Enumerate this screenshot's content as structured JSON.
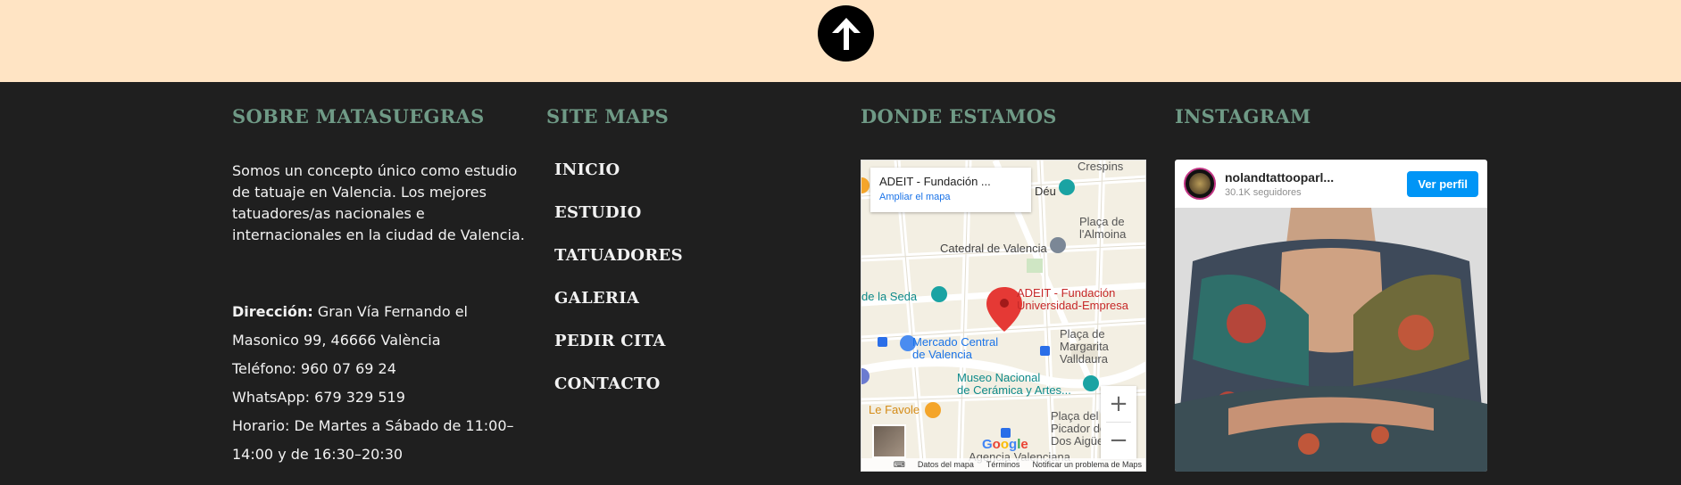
{
  "back_to_top": {
    "icon": "arrow-up-icon"
  },
  "columns": {
    "about": {
      "title": "SOBRE MATASUEGRAS",
      "text": "Somos un concepto único como estudio de tatuaje en Valencia. Los mejores tatuadores/as nacionales e internacionales en la ciudad de Valencia.",
      "address_label": "Dirección:",
      "address_value": " Gran Vía Fernando el Masonico 99, 46666 València",
      "phone": "Teléfono: 960 07 69 24",
      "whatsapp": "WhatsApp: 679 329 519",
      "hours": "Horario: De Martes a Sábado de 11:00–14:00 y de 16:30–20:30"
    },
    "sitemap": {
      "title": "SITE MAPS",
      "items": [
        "INICIO",
        "ESTUDIO",
        "TATUADORES",
        "GALERIA",
        "PEDIR CITA",
        "CONTACTO"
      ]
    },
    "location": {
      "title": "DONDE ESTAMOS",
      "map": {
        "card_title": "ADEIT - Fundación ...",
        "card_link": "Ampliar el mapa",
        "pin_label": "ADEIT - Fundación\nUniversidad-Empresa",
        "labels": {
          "catedral": "Catedral de Valencia",
          "seda": "de la Seda",
          "mercado": "Mercado Central\nde Valencia",
          "museo": "Museo Nacional\nde Cerámica y Artes...",
          "favole": "Le Favole",
          "margarita": "Plaça de\nMargarita\nValldaura",
          "almoina": "Plaça de\nl'Almoina",
          "picador": "Plaça del\nPicador de\nDos Aigües",
          "crespins": "Crespins",
          "deu": "Déu",
          "agencia": "Agencia Valenciana"
        },
        "zoom_in": "+",
        "zoom_out": "−",
        "google": "Google",
        "footer": [
          "Datos del mapa",
          "Términos",
          "Notificar un problema de Maps"
        ]
      }
    },
    "instagram": {
      "title": "INSTAGRAM",
      "username": "nolandtattooparl...",
      "followers": "30.1K seguidores",
      "button": "Ver perfil"
    }
  },
  "colors": {
    "topbar": "#ffe4c4",
    "footer_bg": "#1f1f1f",
    "title": "#6f9a86",
    "text": "#f2f2f2",
    "insta_button": "#0095f6"
  }
}
